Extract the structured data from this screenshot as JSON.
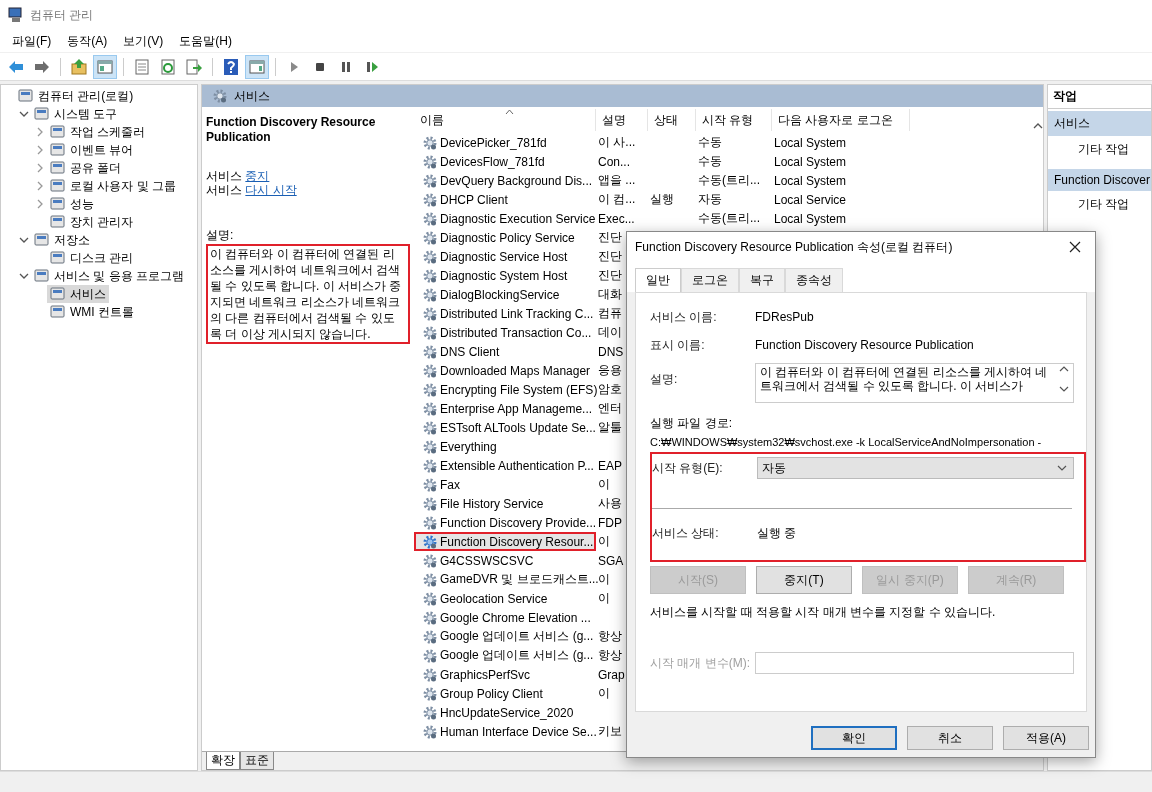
{
  "window": {
    "title": "컴퓨터 관리"
  },
  "menu": [
    "파일(F)",
    "동작(A)",
    "보기(V)",
    "도움말(H)"
  ],
  "toolbar": [
    {
      "kind": "back",
      "pressed": false
    },
    {
      "kind": "forward",
      "pressed": false
    },
    {
      "kind": "separator"
    },
    {
      "kind": "up",
      "pressed": false
    },
    {
      "kind": "console",
      "pressed": true
    },
    {
      "kind": "separator"
    },
    {
      "kind": "properties",
      "pressed": false
    },
    {
      "kind": "refresh",
      "pressed": false
    },
    {
      "kind": "export",
      "pressed": false
    },
    {
      "kind": "separator"
    },
    {
      "kind": "help",
      "pressed": false
    },
    {
      "kind": "actionpane",
      "pressed": true
    },
    {
      "kind": "separator"
    },
    {
      "kind": "play",
      "pressed": false
    },
    {
      "kind": "stop",
      "pressed": false
    },
    {
      "kind": "pause",
      "pressed": false
    },
    {
      "kind": "resume",
      "pressed": false
    }
  ],
  "tree": [
    {
      "label": "컴퓨터 관리(로컬)",
      "selected": false,
      "children": [
        {
          "label": "시스템 도구",
          "expanded": true,
          "selected": false,
          "children": [
            {
              "label": "작업 스케줄러",
              "expanded": false,
              "selected": false
            },
            {
              "label": "이벤트 뷰어",
              "expanded": false,
              "selected": false
            },
            {
              "label": "공유 폴더",
              "expanded": false,
              "selected": false
            },
            {
              "label": "로컬 사용자 및 그룹",
              "expanded": false,
              "selected": false
            },
            {
              "label": "성능",
              "expanded": false,
              "selected": false
            },
            {
              "label": "장치 관리자",
              "selected": false
            }
          ]
        },
        {
          "label": "저장소",
          "expanded": true,
          "selected": false,
          "children": [
            {
              "label": "디스크 관리",
              "selected": false
            }
          ]
        },
        {
          "label": "서비스 및 응용 프로그램",
          "expanded": true,
          "selected": false,
          "children": [
            {
              "label": "서비스",
              "selected": true
            },
            {
              "label": "WMI 컨트롤",
              "selected": false
            }
          ]
        }
      ]
    }
  ],
  "main_header": {
    "title": "서비스"
  },
  "detail_panel": {
    "title": "Function Discovery Resource Publication",
    "actions": [
      {
        "prefix": "서비스",
        "link": "중지"
      },
      {
        "prefix": "서비스",
        "link": "다시 시작"
      }
    ],
    "description_label": "설명:",
    "description": "이 컴퓨터와 이 컴퓨터에 연결된 리소스를 게시하여 네트워크에서 검색될 수 있도록 합니다. 이 서비스가 중지되면 네트워크 리소스가 네트워크의 다른 컴퓨터에서 검색될 수 있도록 더 이상 게시되지 않습니다.",
    "highlighted": true
  },
  "service_list": {
    "columns": [
      {
        "label": "이름",
        "sorted": true
      },
      {
        "label": "설명",
        "sorted": false
      },
      {
        "label": "상태",
        "sorted": false
      },
      {
        "label": "시작 유형",
        "sorted": false
      },
      {
        "label": "다음 사용자로 로그온",
        "sorted": false
      }
    ],
    "rows": [
      {
        "name": "DevicePicker_781fd",
        "description": "이 사...",
        "startup": "수동",
        "logon": "Local System",
        "selected": false,
        "highlighted": false
      },
      {
        "name": "DevicesFlow_781fd",
        "description": "Con...",
        "startup": "수동",
        "logon": "Local System",
        "selected": false,
        "highlighted": false
      },
      {
        "name": "DevQuery Background Dis...",
        "description": "앱을 ...",
        "startup": "수동(트리...",
        "logon": "Local System",
        "selected": false,
        "highlighted": false
      },
      {
        "name": "DHCP Client",
        "description": "이 컴...",
        "status": "실행",
        "startup": "자동",
        "logon": "Local Service",
        "selected": false,
        "highlighted": false
      },
      {
        "name": "Diagnostic Execution Service",
        "description": "Exec...",
        "startup": "수동(트리...",
        "logon": "Local System",
        "selected": false,
        "highlighted": false
      },
      {
        "name": "Diagnostic Policy Service",
        "description": "진단",
        "selected": false,
        "highlighted": false
      },
      {
        "name": "Diagnostic Service Host",
        "description": "진단",
        "selected": false,
        "highlighted": false
      },
      {
        "name": "Diagnostic System Host",
        "description": "진단",
        "selected": false,
        "highlighted": false
      },
      {
        "name": "DialogBlockingService",
        "description": "대화",
        "selected": false,
        "highlighted": false
      },
      {
        "name": "Distributed Link Tracking C...",
        "description": "컴퓨",
        "selected": false,
        "highlighted": false
      },
      {
        "name": "Distributed Transaction Co...",
        "description": "데이",
        "selected": false,
        "highlighted": false
      },
      {
        "name": "DNS Client",
        "description": "DNS",
        "selected": false,
        "highlighted": false
      },
      {
        "name": "Downloaded Maps Manager",
        "description": "응용",
        "selected": false,
        "highlighted": false
      },
      {
        "name": "Encrypting File System (EFS)",
        "description": "암호",
        "selected": false,
        "highlighted": false
      },
      {
        "name": "Enterprise App Manageme...",
        "description": "엔터",
        "selected": false,
        "highlighted": false
      },
      {
        "name": "ESTsoft ALTools Update Se...",
        "description": "알툴",
        "selected": false,
        "highlighted": false
      },
      {
        "name": "Everything",
        "selected": false,
        "highlighted": false
      },
      {
        "name": "Extensible Authentication P...",
        "description": "EAP",
        "selected": false,
        "highlighted": false
      },
      {
        "name": "Fax",
        "description": "이",
        "selected": false,
        "highlighted": false
      },
      {
        "name": "File History Service",
        "description": "사용",
        "selected": false,
        "highlighted": false
      },
      {
        "name": "Function Discovery Provide...",
        "description": "FDP",
        "selected": false,
        "highlighted": false
      },
      {
        "name": "Function Discovery Resour...",
        "description": "이",
        "selected": true,
        "highlighted": true
      },
      {
        "name": "G4CSSWSCSVC",
        "description": "SGA",
        "selected": false,
        "highlighted": false
      },
      {
        "name": "GameDVR 및 브로드캐스트...",
        "description": "이",
        "selected": false,
        "highlighted": false
      },
      {
        "name": "Geolocation Service",
        "description": "이",
        "selected": false,
        "highlighted": false
      },
      {
        "name": "Google Chrome Elevation ...",
        "selected": false,
        "highlighted": false
      },
      {
        "name": "Google 업데이트 서비스 (g...",
        "description": "항상",
        "selected": false,
        "highlighted": false
      },
      {
        "name": "Google 업데이트 서비스 (g...",
        "description": "항상",
        "selected": false,
        "highlighted": false
      },
      {
        "name": "GraphicsPerfSvc",
        "description": "Grap",
        "selected": false,
        "highlighted": false
      },
      {
        "name": "Group Policy Client",
        "description": "이",
        "selected": false,
        "highlighted": false
      },
      {
        "name": "HncUpdateService_2020",
        "selected": false,
        "highlighted": false
      },
      {
        "name": "Human Interface Device Se...",
        "description": "키보",
        "selected": false,
        "highlighted": false
      }
    ]
  },
  "view_tabs": [
    {
      "label": "확장",
      "selected": true
    },
    {
      "label": "표준",
      "selected": false
    }
  ],
  "actions_pane": {
    "title": "작업",
    "sections": [
      {
        "title": "서비스",
        "items": [
          "기타 작업"
        ]
      },
      {
        "title": "Function Discover",
        "items": [
          "기타 작업"
        ]
      }
    ]
  },
  "dialog": {
    "title": "Function Discovery Resource Publication 속성(로컬 컴퓨터)",
    "tabs": [
      {
        "label": "일반",
        "selected": true
      },
      {
        "label": "로그온",
        "selected": false
      },
      {
        "label": "복구",
        "selected": false
      },
      {
        "label": "종속성",
        "selected": false
      }
    ],
    "service_name": {
      "label": "서비스 이름:",
      "value": "FDResPub"
    },
    "display_name": {
      "label": "표시 이름:",
      "value": "Function Discovery Resource Publication"
    },
    "description": {
      "label": "설명:",
      "value": "이 컴퓨터와 이 컴퓨터에 연결된 리소스를 게시하여 네트워크에서 검색될 수 있도록 합니다. 이 서비스가"
    },
    "path": {
      "label": "실행 파일 경로:",
      "value": "C:₩WINDOWS₩system32₩svchost.exe -k LocalServiceAndNoImpersonation -"
    },
    "startup_section": {
      "highlighted": true,
      "startup_label": "시작 유형(E):",
      "startup_value": "자동",
      "status_label": "서비스 상태:",
      "status_value": "실행 중"
    },
    "control_buttons": [
      {
        "label": "시작(S)",
        "disabled": true
      },
      {
        "label": "중지(T)",
        "disabled": false
      },
      {
        "label": "일시 중지(P)",
        "disabled": true
      },
      {
        "label": "계속(R)",
        "disabled": true
      }
    ],
    "hint": "서비스를 시작할 때 적용할 시작 매개 변수를 지정할 수 있습니다.",
    "parameters": {
      "label": "시작 매개 변수(M):",
      "disabled": true
    },
    "buttons": [
      {
        "label": "확인",
        "default": true
      },
      {
        "label": "취소",
        "default": false
      },
      {
        "label": "적용(A)",
        "default": false
      }
    ]
  }
}
